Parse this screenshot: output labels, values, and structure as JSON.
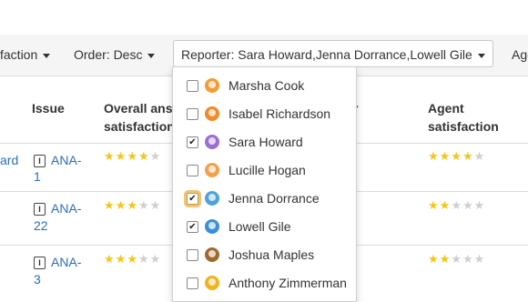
{
  "filters": {
    "satisfaction": "faction",
    "order": "Order: Desc",
    "reporter": "Reporter: Sara Howard,Jenna Dorrance,Lowell Gile",
    "agent": "Age"
  },
  "table": {
    "headers": {
      "issue": "Issue",
      "overall_line1": "Overall ans",
      "overall_line2": "satisfaction",
      "agent_line1": "Agent",
      "agent_line2": "satisfaction",
      "fragment": "r"
    },
    "rows": [
      {
        "left_text": "ard",
        "issue_line1": "ANA-",
        "issue_line2": "1",
        "overall_rating": 4,
        "agent_rating": 4
      },
      {
        "left_text": "",
        "issue_line1": "ANA-",
        "issue_line2": "22",
        "overall_rating": 3,
        "agent_rating": 2
      },
      {
        "left_text": "",
        "issue_line1": "ANA-",
        "issue_line2": "3",
        "overall_rating": 3,
        "agent_rating": 2
      }
    ],
    "max_rating": 5
  },
  "issue_type_glyph": "I",
  "reporter_dropdown": {
    "items": [
      {
        "name": "Marsha Cook",
        "checked": false,
        "avatar_color": "#f39c33",
        "avatar_icon": "avatar-icon"
      },
      {
        "name": "Isabel Richardson",
        "checked": false,
        "avatar_color": "#f08a2a",
        "avatar_icon": "avatar-icon"
      },
      {
        "name": "Sara Howard",
        "checked": true,
        "avatar_color": "#9b6fd1",
        "avatar_icon": "avatar-icon"
      },
      {
        "name": "Lucille Hogan",
        "checked": false,
        "avatar_color": "#f3a04d",
        "avatar_icon": "avatar-icon"
      },
      {
        "name": "Jenna Dorrance",
        "checked": true,
        "avatar_color": "#4fa3d8",
        "avatar_icon": "avatar-icon",
        "focused": true
      },
      {
        "name": "Lowell Gile",
        "checked": true,
        "avatar_color": "#3b8fd9",
        "avatar_icon": "avatar-icon"
      },
      {
        "name": "Joshua Maples",
        "checked": false,
        "avatar_color": "#a0692f",
        "avatar_icon": "avatar-icon"
      },
      {
        "name": "Anthony Zimmerman",
        "checked": false,
        "avatar_color": "#f2b21f",
        "avatar_icon": "avatar-icon"
      }
    ]
  },
  "colors": {
    "link": "#2a6ebb",
    "star_on": "#f5c518",
    "star_off": "#cfcfcf",
    "focus_ring": "#f0c37a"
  },
  "glyphs": {
    "star": "★",
    "check": "✔"
  }
}
